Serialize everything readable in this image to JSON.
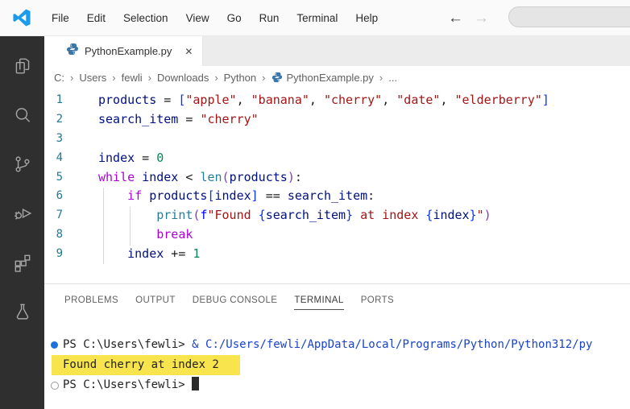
{
  "colors": {
    "titlebar_bg": "#FAFAFA",
    "activity_bg": "#2F2F2F",
    "activity_icon": "#A6A6A6",
    "tabstrip_bg": "#ECECEC",
    "tab_active_bg": "#FFFFFF",
    "breadcrumb": "#616161",
    "line_number": "#237893",
    "kw": "#AF00DB",
    "vr": "#001080",
    "st": "#A31515",
    "nm": "#098658",
    "fn": "#267F99",
    "op": "#1B1B1B",
    "bb": "#0431FA",
    "bp": "#7B3AC4",
    "fp": "#0000FF",
    "panel_tab": "#616161",
    "panel_tab_active": "#3B3B3B",
    "term_text": "#212121",
    "term_cmd": "#1A43CC",
    "highlight": "#F8E44C",
    "deco_blue": "#1A73D9",
    "deco_hollow": "#999999",
    "python_icon": "#3A76A8",
    "logo_blue": "#1B9BE9"
  },
  "titlebar": {
    "menus": [
      "File",
      "Edit",
      "Selection",
      "View",
      "Go",
      "Run",
      "Terminal",
      "Help"
    ],
    "back_arrow": "←",
    "forward_arrow": "→",
    "search_value": ""
  },
  "tab": {
    "label": "PythonExample.py",
    "close": "✕"
  },
  "breadcrumb": {
    "separator": "›",
    "items": [
      {
        "label": "C:"
      },
      {
        "label": "Users"
      },
      {
        "label": "fewli"
      },
      {
        "label": "Downloads"
      },
      {
        "label": "Python"
      },
      {
        "label": "PythonExample.py",
        "icon": "python-icon"
      },
      {
        "label": "..."
      }
    ]
  },
  "activity_bar": {
    "items": [
      "explorer-icon",
      "search-icon",
      "source-control-icon",
      "run-debug-icon",
      "extensions-icon",
      "testing-icon"
    ]
  },
  "editor": {
    "lines": [
      {
        "n": "1",
        "tokens": [
          [
            "vr",
            "products"
          ],
          [
            "op",
            " = "
          ],
          [
            "bb",
            "["
          ],
          [
            "st",
            "\"apple\""
          ],
          [
            "op",
            ", "
          ],
          [
            "st",
            "\"banana\""
          ],
          [
            "op",
            ", "
          ],
          [
            "st",
            "\"cherry\""
          ],
          [
            "op",
            ", "
          ],
          [
            "st",
            "\"date\""
          ],
          [
            "op",
            ", "
          ],
          [
            "st",
            "\"elderberry\""
          ],
          [
            "bb",
            "]"
          ]
        ]
      },
      {
        "n": "2",
        "tokens": [
          [
            "vr",
            "search_item"
          ],
          [
            "op",
            " = "
          ],
          [
            "st",
            "\"cherry\""
          ]
        ]
      },
      {
        "n": "3",
        "tokens": []
      },
      {
        "n": "4",
        "tokens": [
          [
            "vr",
            "index"
          ],
          [
            "op",
            " = "
          ],
          [
            "nm",
            "0"
          ]
        ]
      },
      {
        "n": "5",
        "tokens": [
          [
            "kw",
            "while"
          ],
          [
            "op",
            " "
          ],
          [
            "vr",
            "index"
          ],
          [
            "op",
            " < "
          ],
          [
            "fn",
            "len"
          ],
          [
            "bp",
            "("
          ],
          [
            "vr",
            "products"
          ],
          [
            "bp",
            ")"
          ],
          [
            "op",
            ":"
          ]
        ]
      },
      {
        "n": "6",
        "tokens": [
          [
            "op",
            "    "
          ],
          [
            "kw",
            "if"
          ],
          [
            "op",
            " "
          ],
          [
            "vr",
            "products"
          ],
          [
            "bb",
            "["
          ],
          [
            "vr",
            "index"
          ],
          [
            "bb",
            "]"
          ],
          [
            "op",
            " == "
          ],
          [
            "vr",
            "search_item"
          ],
          [
            "op",
            ":"
          ]
        ]
      },
      {
        "n": "7",
        "tokens": [
          [
            "op",
            "        "
          ],
          [
            "fn",
            "print"
          ],
          [
            "bp",
            "("
          ],
          [
            "fp",
            "f"
          ],
          [
            "st",
            "\"Found "
          ],
          [
            "bb",
            "{"
          ],
          [
            "vr",
            "search_item"
          ],
          [
            "bb",
            "}"
          ],
          [
            "st",
            " at index "
          ],
          [
            "bb",
            "{"
          ],
          [
            "vr",
            "index"
          ],
          [
            "bb",
            "}"
          ],
          [
            "st",
            "\""
          ],
          [
            "bp",
            ")"
          ]
        ]
      },
      {
        "n": "8",
        "tokens": [
          [
            "op",
            "        "
          ],
          [
            "kw",
            "break"
          ]
        ]
      },
      {
        "n": "9",
        "tokens": [
          [
            "op",
            "    "
          ],
          [
            "vr",
            "index"
          ],
          [
            "op",
            " += "
          ],
          [
            "nm",
            "1"
          ]
        ]
      }
    ]
  },
  "panel": {
    "tabs": [
      {
        "label": "PROBLEMS",
        "active": false
      },
      {
        "label": "OUTPUT",
        "active": false
      },
      {
        "label": "DEBUG CONSOLE",
        "active": false
      },
      {
        "label": "TERMINAL",
        "active": true
      },
      {
        "label": "PORTS",
        "active": false
      }
    ]
  },
  "terminal": {
    "lines": [
      {
        "deco": "filled",
        "segments": [
          [
            "df",
            "PS C:\\Users\\fewli> "
          ],
          [
            "cmd",
            "& C:/Users/fewli/AppData/Local/Programs/Python/Python312/py"
          ]
        ]
      },
      {
        "highlight": true,
        "segments": [
          [
            "df",
            "Found cherry at index 2"
          ]
        ]
      },
      {
        "deco": "hollow",
        "segments": [
          [
            "df",
            "PS C:\\Users\\fewli> "
          ]
        ],
        "cursor": true
      }
    ]
  }
}
